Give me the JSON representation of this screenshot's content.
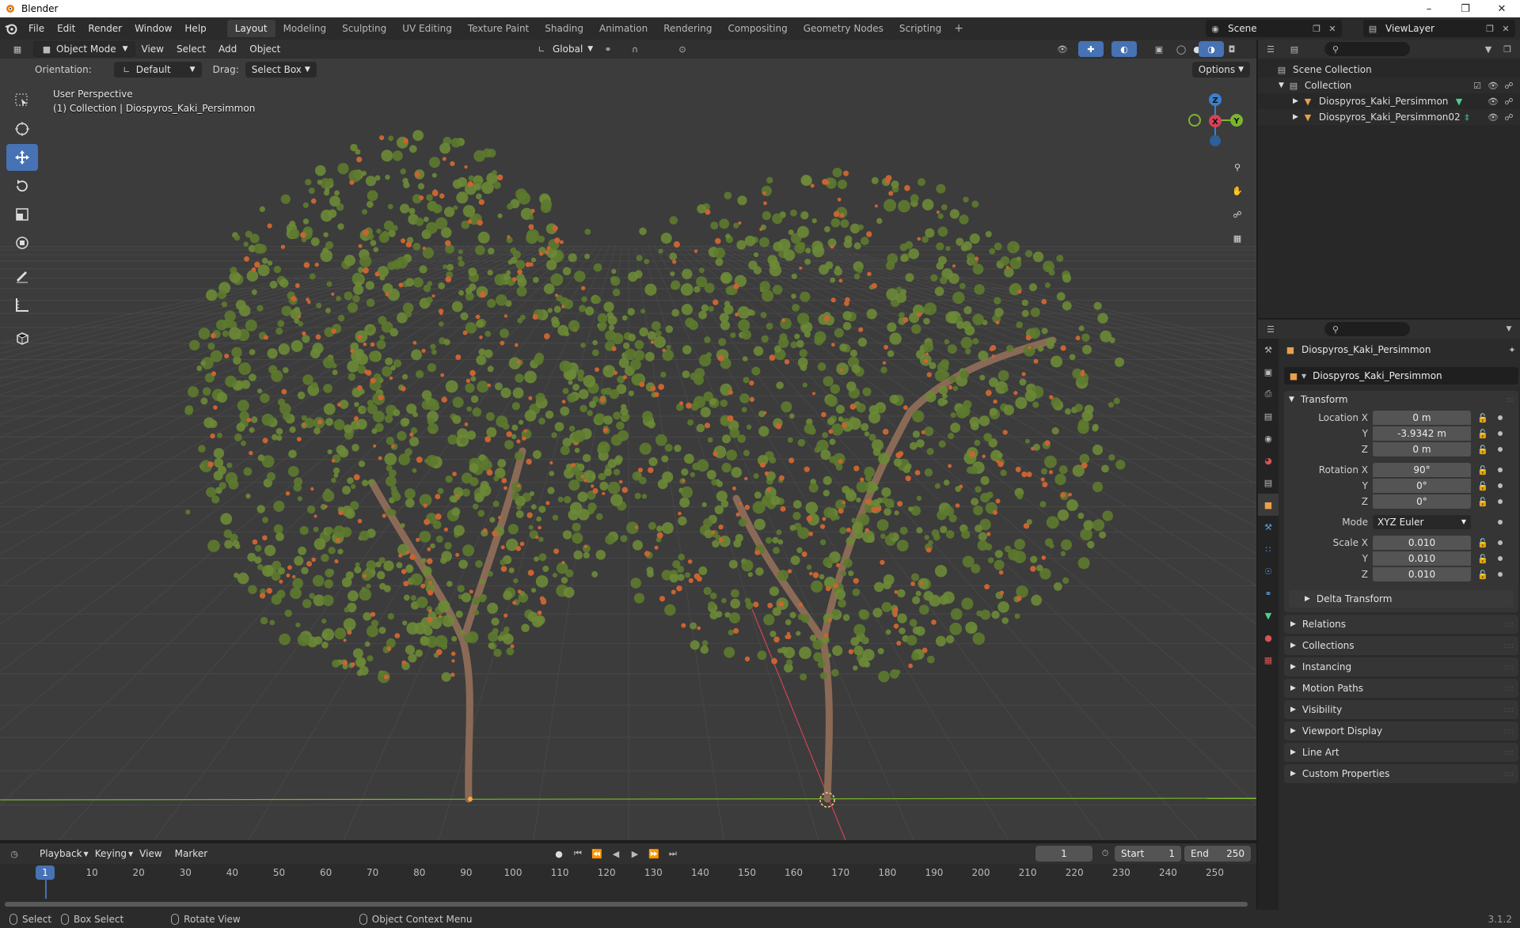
{
  "window": {
    "title": "Blender",
    "controls": [
      "minimize",
      "maximize",
      "close"
    ]
  },
  "menu": [
    "File",
    "Edit",
    "Render",
    "Window",
    "Help"
  ],
  "workspace_tabs": [
    {
      "label": "Layout",
      "active": true
    },
    {
      "label": "Modeling"
    },
    {
      "label": "Sculpting"
    },
    {
      "label": "UV Editing"
    },
    {
      "label": "Texture Paint"
    },
    {
      "label": "Shading"
    },
    {
      "label": "Animation"
    },
    {
      "label": "Rendering"
    },
    {
      "label": "Compositing"
    },
    {
      "label": "Geometry Nodes"
    },
    {
      "label": "Scripting"
    }
  ],
  "scene": "Scene",
  "view_layer": "ViewLayer",
  "viewport": {
    "mode": "Object Mode",
    "menus": [
      "View",
      "Select",
      "Add",
      "Object"
    ],
    "transform_orientation": "Global",
    "orientation_label": "Orientation:",
    "orientation_value": "Default",
    "drag_label": "Drag:",
    "drag_value": "Select Box",
    "options": "Options",
    "perspective": "User Perspective",
    "collection_info": "(1) Collection | Diospyros_Kaki_Persimmon",
    "gizmo_axes": [
      "Z",
      "X",
      "Y"
    ],
    "colors": {
      "background": "#3c3c3c",
      "x_axis": "#d44256",
      "y_axis": "#7ab62d",
      "z_axis": "#3a80cc",
      "foliage": "#5d7a2f",
      "fruit": "#c96432",
      "trunk": "#8a6a56"
    }
  },
  "outliner": {
    "root": "Scene Collection",
    "collection": "Collection",
    "objects": [
      "Diospyros_Kaki_Persimmon",
      "Diospyros_Kaki_Persimmon02"
    ]
  },
  "properties": {
    "object_title": "Diospyros_Kaki_Persimmon",
    "object_name": "Diospyros_Kaki_Persimmon",
    "transform": {
      "title": "Transform",
      "location_label": "Location X",
      "location": [
        "0 m",
        "-3.9342 m",
        "0 m"
      ],
      "rotation_label": "Rotation X",
      "rotation": [
        "90°",
        "0°",
        "0°"
      ],
      "mode_label": "Mode",
      "mode": "XYZ Euler",
      "scale_label": "Scale X",
      "scale": [
        "0.010",
        "0.010",
        "0.010"
      ],
      "y_label": "Y",
      "z_label": "Z"
    },
    "delta_transform": "Delta Transform",
    "panels": [
      "Relations",
      "Collections",
      "Instancing",
      "Motion Paths",
      "Visibility",
      "Viewport Display",
      "Line Art",
      "Custom Properties"
    ]
  },
  "timeline": {
    "menus": [
      "Playback",
      "Keying",
      "View",
      "Marker"
    ],
    "current_frame": "1",
    "start_label": "Start",
    "start": "1",
    "end_label": "End",
    "end": "250",
    "ruler": [
      "10",
      "20",
      "30",
      "40",
      "50",
      "60",
      "70",
      "80",
      "90",
      "100",
      "110",
      "120",
      "130",
      "140",
      "150",
      "160",
      "170",
      "180",
      "190",
      "200",
      "210",
      "220",
      "230",
      "240",
      "250"
    ],
    "cursor": "1"
  },
  "status": {
    "items": [
      "Select",
      "Box Select",
      "Rotate View",
      "Object Context Menu"
    ],
    "version": "3.1.2"
  }
}
